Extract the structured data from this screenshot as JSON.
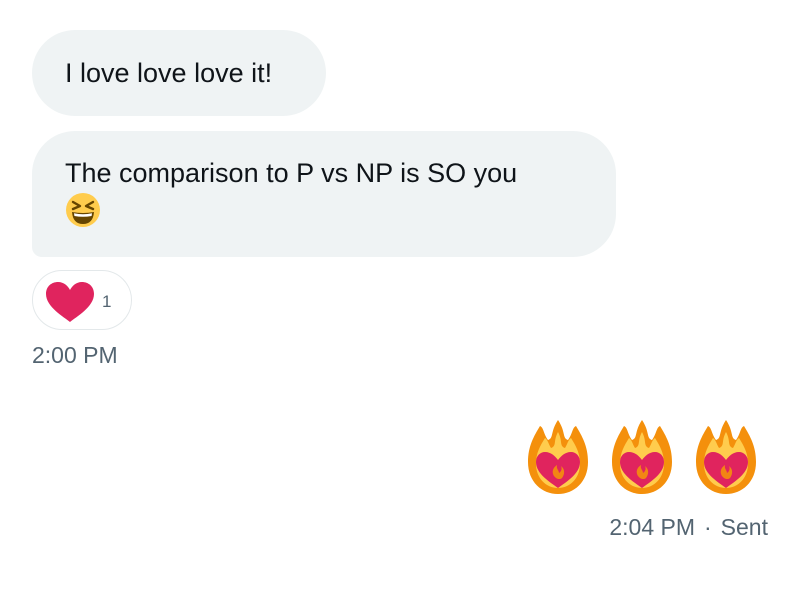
{
  "messages": {
    "received_1": {
      "text": "I love love love it!"
    },
    "received_2": {
      "line_1": "The comparison to P vs NP is SO you",
      "emoji": "grinning-squinting-face-icon"
    },
    "reaction": {
      "emoji": "red-heart-icon",
      "count": "1"
    },
    "received_time": "2:00 PM",
    "sent_1": {
      "emojis": [
        "heart-on-fire-icon",
        "heart-on-fire-icon",
        "heart-on-fire-icon"
      ],
      "time": "2:04 PM",
      "separator": "·",
      "status": "Sent"
    }
  },
  "colors": {
    "bubble_background": "#eff3f4",
    "secondary_text": "#536471",
    "primary_text": "#0f1419",
    "heart_red": "#e0245e",
    "fire_orange": "#f4900c",
    "fire_yellow": "#ffcc4d"
  }
}
